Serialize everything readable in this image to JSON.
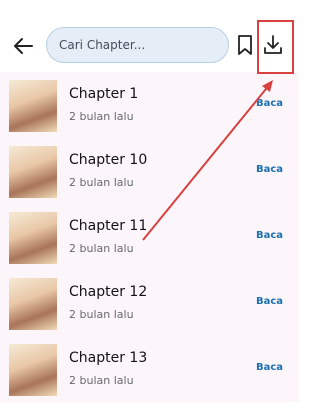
{
  "search": {
    "placeholder": "Cari Chapter..."
  },
  "icons": {
    "back": "arrow-left-icon",
    "bookmark": "bookmark-icon",
    "download": "download-icon"
  },
  "colors": {
    "accent": "#1a6fae",
    "highlight": "#d94040",
    "row_bg": "#fcf6fb"
  },
  "chapters": [
    {
      "title": "Chapter 1",
      "time": "2 bulan lalu",
      "action": "Baca"
    },
    {
      "title": "Chapter 10",
      "time": "2 bulan lalu",
      "action": "Baca"
    },
    {
      "title": "Chapter 11",
      "time": "2 bulan lalu",
      "action": "Baca"
    },
    {
      "title": "Chapter 12",
      "time": "2 bulan lalu",
      "action": "Baca"
    },
    {
      "title": "Chapter 13",
      "time": "2 bulan lalu",
      "action": "Baca"
    }
  ]
}
